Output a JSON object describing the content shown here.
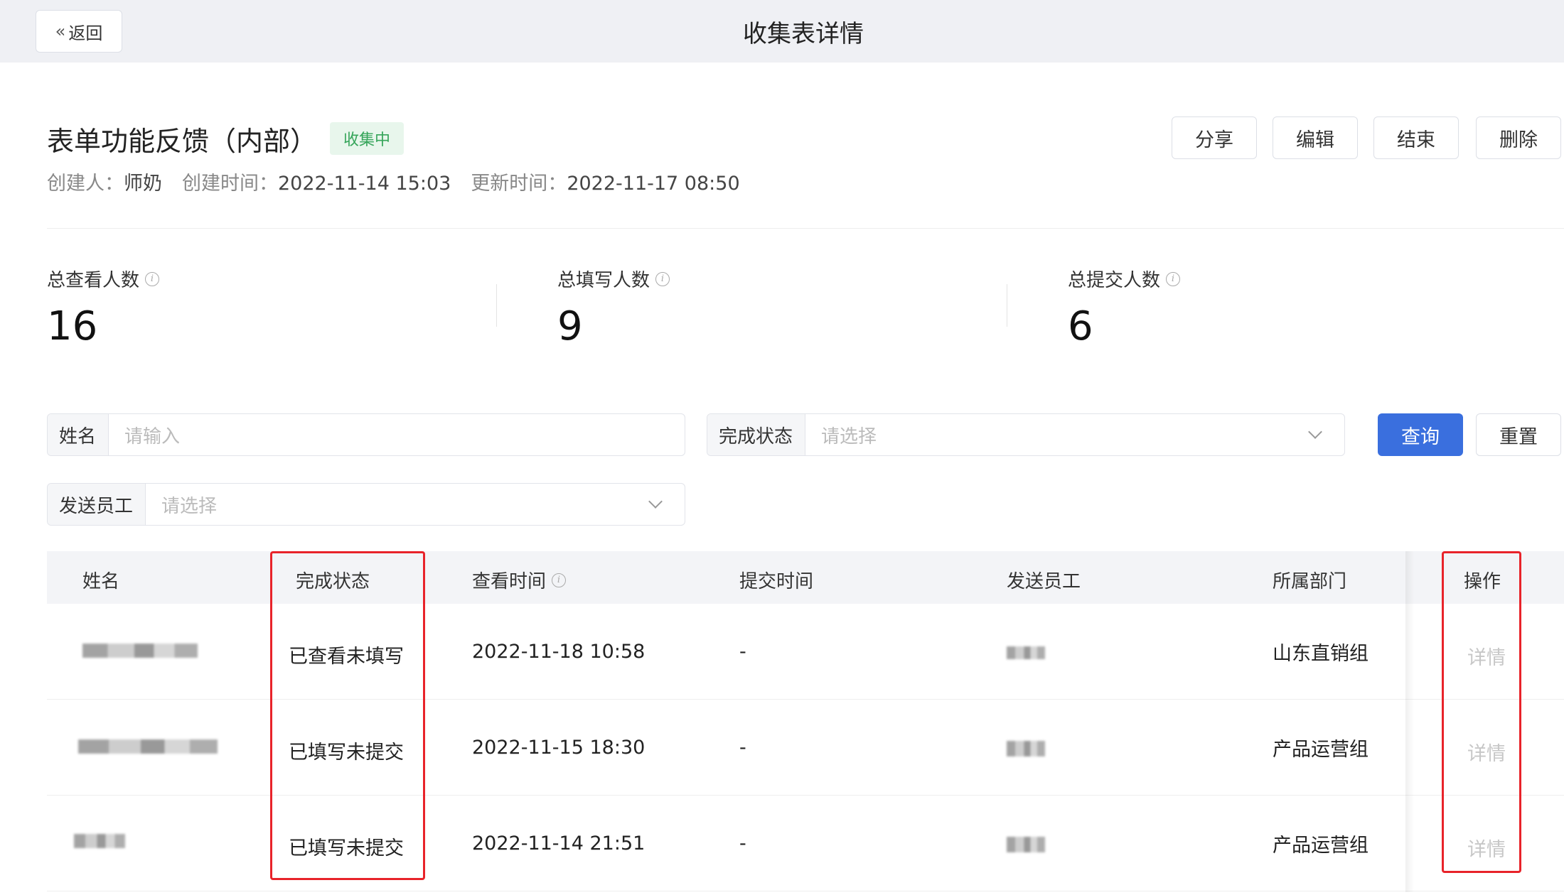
{
  "header": {
    "back_label": "返回",
    "title": "收集表详情"
  },
  "form": {
    "title": "表单功能反馈（内部）",
    "status": "收集中",
    "creator_label": "创建人：",
    "creator": "师奶",
    "created_label": "创建时间：",
    "created": "2022-11-14 15:03",
    "updated_label": "更新时间：",
    "updated": "2022-11-17 08:50"
  },
  "actions": {
    "share": "分享",
    "edit": "编辑",
    "end": "结束",
    "delete": "删除"
  },
  "stats": [
    {
      "label": "总查看人数",
      "value": "16"
    },
    {
      "label": "总填写人数",
      "value": "9"
    },
    {
      "label": "总提交人数",
      "value": "6"
    }
  ],
  "filters": {
    "name_label": "姓名",
    "name_placeholder": "请输入",
    "status_label": "完成状态",
    "status_placeholder": "请选择",
    "sender_label": "发送员工",
    "sender_placeholder": "请选择",
    "query": "查询",
    "reset": "重置"
  },
  "table": {
    "columns": [
      "姓名",
      "完成状态",
      "查看时间",
      "提交时间",
      "发送员工",
      "所属部门",
      "操作"
    ],
    "rows": [
      {
        "status": "已查看未填写",
        "view_time": "2022-11-18 10:58",
        "submit_time": "-",
        "dept": "山东直销组",
        "action": "详情"
      },
      {
        "status": "已填写未提交",
        "view_time": "2022-11-15 18:30",
        "submit_time": "-",
        "dept": "产品运营组",
        "action": "详情"
      },
      {
        "status": "已填写未提交",
        "view_time": "2022-11-14 21:51",
        "submit_time": "-",
        "dept": "产品运营组",
        "action": "详情"
      }
    ]
  },
  "colors": {
    "primary": "#3a6fde",
    "badge_bg": "#e8f6ec",
    "badge_text": "#36a55a",
    "highlight": "#e8232a",
    "header_bg": "#eff0f4"
  }
}
